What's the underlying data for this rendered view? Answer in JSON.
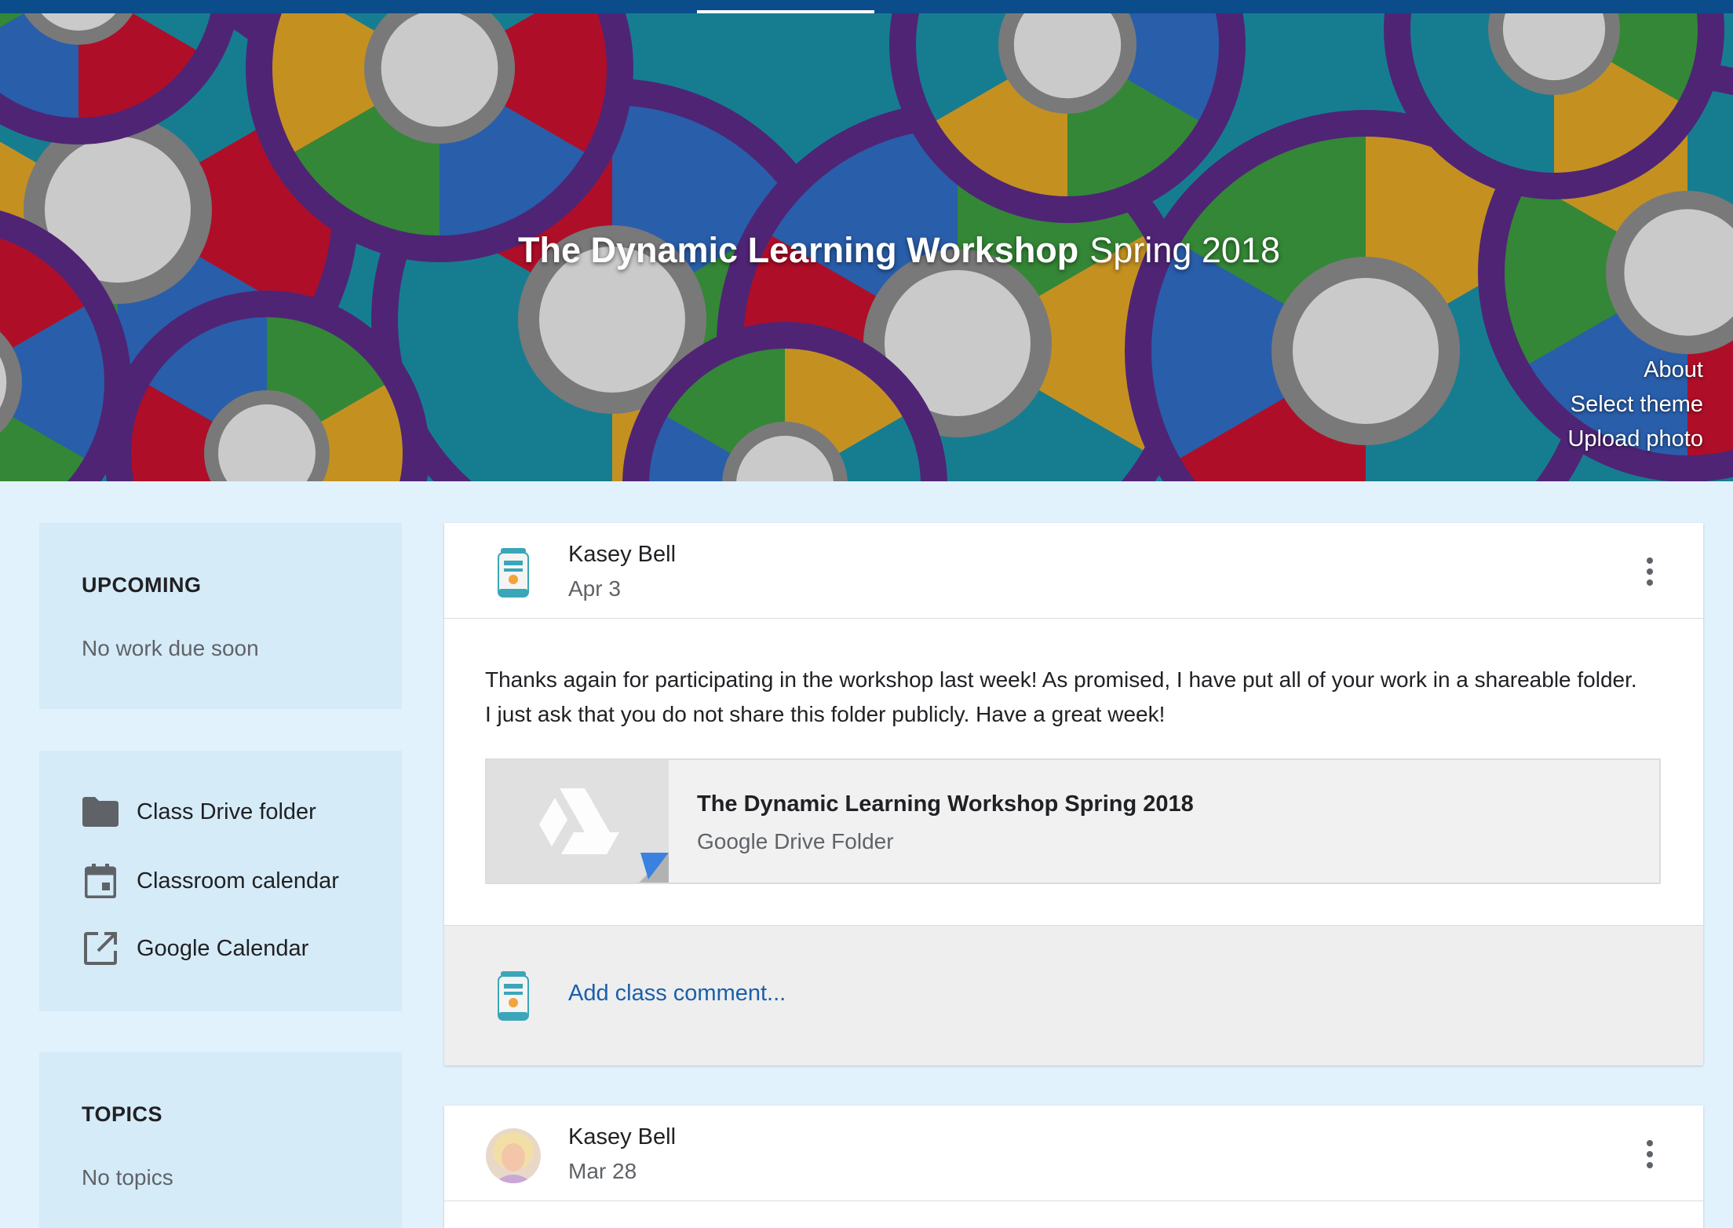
{
  "header": {
    "class_name": "The Dynamic Learning Workshop",
    "class_section": "Spring 2018",
    "about": "About",
    "select_theme": "Select theme",
    "upload_photo": "Upload photo"
  },
  "sidebar": {
    "upcoming": {
      "heading": "UPCOMING",
      "empty_text": "No work due soon"
    },
    "links": [
      {
        "label": "Class Drive folder",
        "icon": "folder-icon"
      },
      {
        "label": "Classroom calendar",
        "icon": "calendar-icon"
      },
      {
        "label": "Google Calendar",
        "icon": "open-in-new-icon"
      }
    ],
    "topics": {
      "heading": "TOPICS",
      "empty_text": "No topics"
    }
  },
  "posts": [
    {
      "author": "Kasey Bell",
      "date": "Apr 3",
      "body": "Thanks again for participating in the workshop last week! As promised, I have put all of your work in a shareable folder. I just ask that you do not share this folder publicly. Have a great week!",
      "attachment": {
        "title": "The Dynamic Learning Workshop Spring 2018",
        "subtitle": "Google Drive Folder"
      },
      "comment_placeholder": "Add class comment..."
    },
    {
      "author": "Kasey Bell",
      "date": "Mar 28"
    }
  ],
  "colors": {
    "topbar": "#0b4c8a",
    "page_bg": "#e1f2fd",
    "sidebar_card": "#d6ebf8",
    "link_blue": "#1a5fab",
    "banner_teal": "#1a8fa6",
    "banner_red": "#c8102e",
    "banner_gold": "#e0a526",
    "banner_green": "#3c9a3e",
    "banner_blue": "#2f6bc2",
    "banner_purple": "#5b2a86"
  }
}
